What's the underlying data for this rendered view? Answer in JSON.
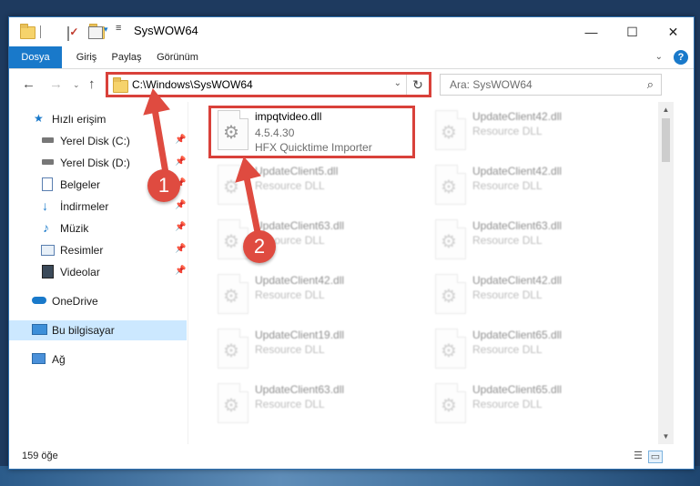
{
  "window": {
    "title": "SysWOW64",
    "controls": {
      "minimize": "—",
      "maximize": "☐",
      "close": "✕"
    }
  },
  "ribbon": {
    "tabs": [
      {
        "label": "Dosya"
      },
      {
        "label": "Giriş"
      },
      {
        "label": "Paylaş"
      },
      {
        "label": "Görünüm"
      }
    ],
    "help_label": "?"
  },
  "nav": {
    "address": "C:\\Windows\\SysWOW64",
    "search_placeholder": "Ara: SysWOW64"
  },
  "sidebar": {
    "items": [
      {
        "label": "Hızlı erişim",
        "icon": "star-icon",
        "pinned": false
      },
      {
        "label": "Yerel Disk (C:)",
        "icon": "drive-icon",
        "pinned": true
      },
      {
        "label": "Yerel Disk (D:)",
        "icon": "drive-icon",
        "pinned": true
      },
      {
        "label": "Belgeler",
        "icon": "documents-icon",
        "pinned": true
      },
      {
        "label": "İndirmeler",
        "icon": "download-icon",
        "pinned": true
      },
      {
        "label": "Müzik",
        "icon": "music-icon",
        "pinned": true
      },
      {
        "label": "Resimler",
        "icon": "pictures-icon",
        "pinned": true
      },
      {
        "label": "Videolar",
        "icon": "video-icon",
        "pinned": true
      },
      {
        "label": "OneDrive",
        "icon": "cloud-icon",
        "pinned": false
      },
      {
        "label": "Bu bilgisayar",
        "icon": "computer-icon",
        "pinned": false,
        "selected": true
      },
      {
        "label": "Ağ",
        "icon": "network-icon",
        "pinned": false
      }
    ]
  },
  "files": {
    "highlighted": {
      "name": "impqtvideo.dll",
      "version": "4.5.4.30",
      "description": "HFX Quicktime Importer"
    },
    "left_column": [
      {
        "name": "UpdateClient5.dll",
        "type": "Resource DLL"
      },
      {
        "name": "UpdateClient63.dll",
        "type": "Resource DLL"
      },
      {
        "name": "UpdateClient42.dll",
        "type": "Resource DLL"
      },
      {
        "name": "UpdateClient19.dll",
        "type": "Resource DLL"
      },
      {
        "name": "UpdateClient63.dll",
        "type": "Resource DLL"
      }
    ],
    "right_column": [
      {
        "name": "UpdateClient42.dll",
        "type": "Resource DLL"
      },
      {
        "name": "UpdateClient42.dll",
        "type": "Resource DLL"
      },
      {
        "name": "UpdateClient63.dll",
        "type": "Resource DLL"
      },
      {
        "name": "UpdateClient42.dll",
        "type": "Resource DLL"
      },
      {
        "name": "UpdateClient65.dll",
        "type": "Resource DLL"
      },
      {
        "name": "UpdateClient65.dll",
        "type": "Resource DLL"
      }
    ]
  },
  "status": {
    "item_count": "159 öğe"
  },
  "annotations": {
    "badge1": "1",
    "badge2": "2",
    "color": "#d9413a"
  }
}
